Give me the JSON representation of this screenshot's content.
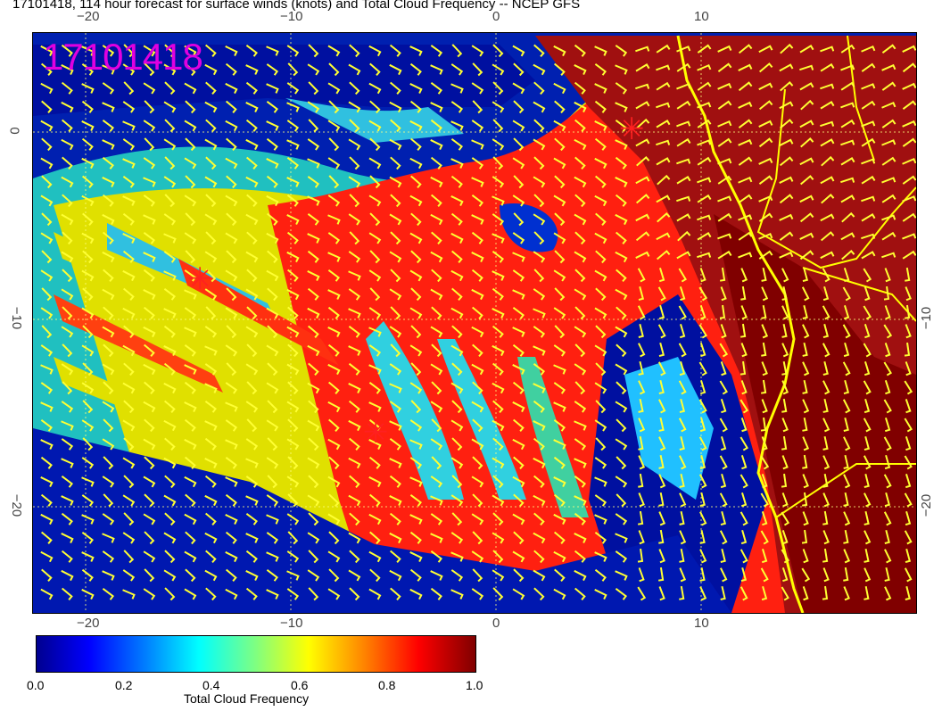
{
  "title": "17101418, 114 hour forecast for surface winds (knots) and Total Cloud Frequency -- NCEP GFS",
  "stamp": "17101418",
  "axes": {
    "x_top": [
      "−20",
      "−10",
      "0",
      "10"
    ],
    "x_bottom": [
      "−20",
      "−10",
      "0",
      "10"
    ],
    "y_left": [
      "0",
      "−10",
      "−20"
    ],
    "y_right": [
      "−10",
      "−20"
    ]
  },
  "colorbar": {
    "label": "Total Cloud Frequency",
    "ticks": [
      "0.0",
      "0.2",
      "0.4",
      "0.6",
      "0.8",
      "1.0"
    ],
    "colors": [
      "#00008f",
      "#0000ff",
      "#0080ff",
      "#00ffff",
      "#80ff80",
      "#ffff00",
      "#ff8000",
      "#ff0000",
      "#800000"
    ]
  },
  "markers": {
    "symbol": "✳",
    "color": "#ff2020"
  },
  "wind_barb_color": "#ffff33",
  "coastline_color": "#ffff00"
}
